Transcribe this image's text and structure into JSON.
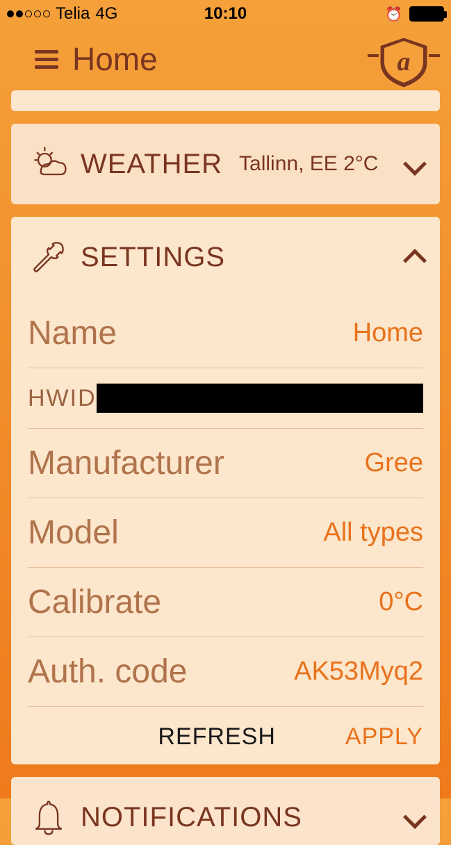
{
  "statusbar": {
    "carrier": "Telia",
    "network": "4G",
    "time": "10:10"
  },
  "header": {
    "title": "Home"
  },
  "weather": {
    "title": "WEATHER",
    "summary": "Tallinn, EE 2°C"
  },
  "settings": {
    "title": "SETTINGS",
    "rows": {
      "name": {
        "label": "Name",
        "value": "Home"
      },
      "hwid": {
        "label": "HWID"
      },
      "manufacturer": {
        "label": "Manufacturer",
        "value": "Gree"
      },
      "model": {
        "label": "Model",
        "value": "All types"
      },
      "calibrate": {
        "label": "Calibrate",
        "value": "0°C"
      },
      "authcode": {
        "label": "Auth. code",
        "value": "AK53Myq2"
      }
    },
    "refresh": "REFRESH",
    "apply": "APPLY"
  },
  "notifications": {
    "title": "NOTIFICATIONS"
  }
}
